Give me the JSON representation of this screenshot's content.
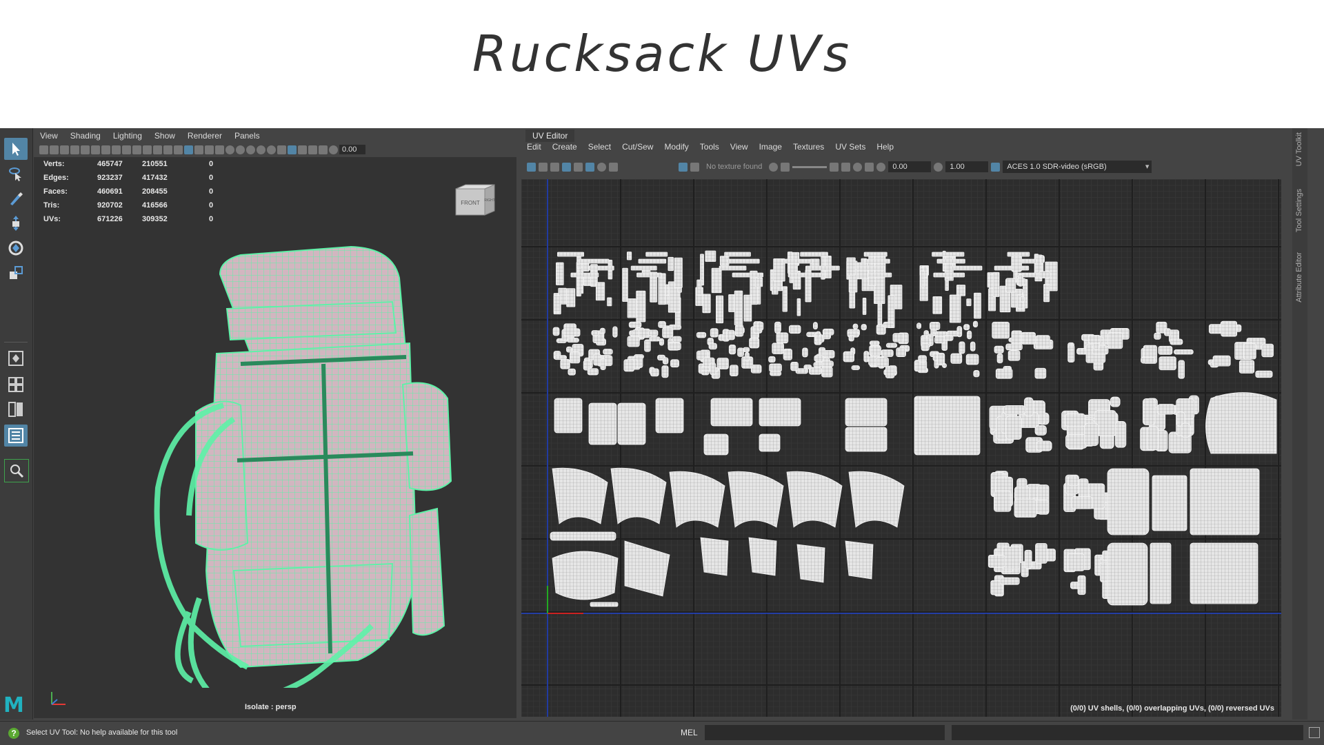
{
  "slide": {
    "title": "Rucksack UVs"
  },
  "viewport": {
    "menus": [
      "View",
      "Shading",
      "Lighting",
      "Show",
      "Renderer",
      "Panels"
    ],
    "toolbar_value": "0.00",
    "hud": [
      {
        "label": "Verts:",
        "a": "465747",
        "b": "210551",
        "c": "0"
      },
      {
        "label": "Edges:",
        "a": "923237",
        "b": "417432",
        "c": "0"
      },
      {
        "label": "Faces:",
        "a": "460691",
        "b": "208455",
        "c": "0"
      },
      {
        "label": "Tris:",
        "a": "920702",
        "b": "416566",
        "c": "0"
      },
      {
        "label": "UVs:",
        "a": "671226",
        "b": "309352",
        "c": "0"
      }
    ],
    "viewcube": {
      "front": "FRONT",
      "right": "RIGHT"
    },
    "isolate_label": "Isolate : persp",
    "mesh_color": "#5ef2a8"
  },
  "uv_editor": {
    "tab": "UV Editor",
    "menus": [
      "Edit",
      "Create",
      "Select",
      "Cut/Sew",
      "Modify",
      "Tools",
      "View",
      "Image",
      "Textures",
      "UV Sets",
      "Help"
    ],
    "no_texture": "No texture found",
    "field_a": "0.00",
    "field_b": "1.00",
    "color_space": "ACES 1.0 SDR-video (sRGB)",
    "status": "(0/0) UV shells, (0/0) overlapping UVs, (0/0) reversed UVs",
    "side_tabs": [
      "UV Toolkit",
      "Tool Settings",
      "Attribute Editor"
    ]
  },
  "statusbar": {
    "help": "Select UV Tool: No help available for this tool",
    "mel": "MEL"
  },
  "colors": {
    "accent": "#5285a6",
    "uv_shell": "#e6e6e6",
    "grid": "#1f1f1f"
  }
}
